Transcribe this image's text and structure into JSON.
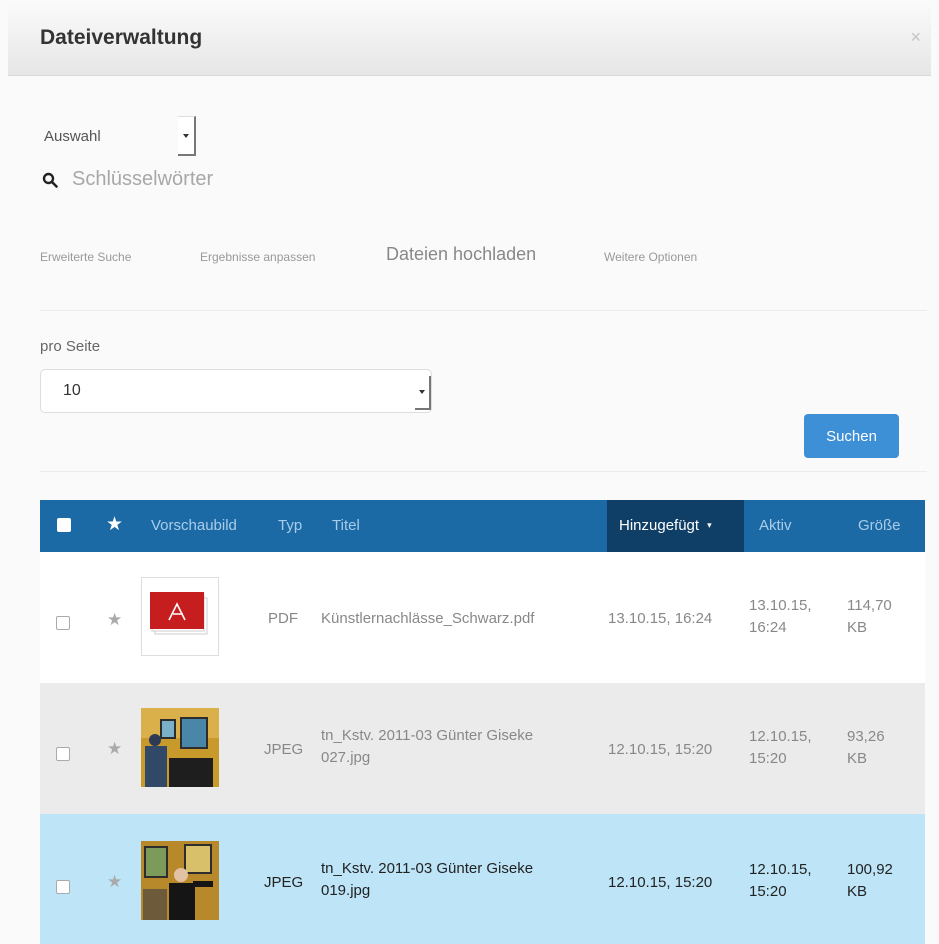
{
  "dialog": {
    "title": "Dateiverwaltung",
    "close": "×"
  },
  "auswahl": {
    "label": "Auswahl"
  },
  "search": {
    "placeholder": "Schlüsselwörter"
  },
  "tabs": [
    "Erweiterte Suche",
    "Ergebnisse anpassen",
    "Dateien hochladen",
    "Weitere Optionen"
  ],
  "per_page": {
    "label": "pro Seite",
    "value": "10"
  },
  "search_button": "Suchen",
  "table": {
    "columns": {
      "preview": "Vorschaubild",
      "type": "Typ",
      "title": "Titel",
      "added": "Hinzugefügt",
      "active": "Aktiv",
      "size": "Größe"
    },
    "sorted_indicator": "▾",
    "rows": [
      {
        "type": "PDF",
        "title_line1": "Künstlernachlässe_Schwarz.pdf",
        "title_line2": "",
        "added": "13.10.15, 16:24",
        "active_date": "13.10.15,",
        "active_time": "16:24",
        "size_num": "114,70",
        "size_unit": "KB",
        "thumb": "pdf-icon"
      },
      {
        "type": "JPEG",
        "title_line1": "tn_Kstv. 2011-03 Günter Giseke",
        "title_line2": "027.jpg",
        "added": "12.10.15, 15:20",
        "active_date": "12.10.15,",
        "active_time": "15:20",
        "size_num": "93,26",
        "size_unit": "KB",
        "thumb": "photo-thumbnail"
      },
      {
        "type": "JPEG",
        "title_line1": "tn_Kstv. 2011-03 Günter Giseke",
        "title_line2": "019.jpg",
        "added": "12.10.15, 15:20",
        "active_date": "12.10.15,",
        "active_time": "15:20",
        "size_num": "100,92",
        "size_unit": "KB",
        "thumb": "photo-thumbnail"
      }
    ]
  },
  "colors": {
    "header_blue": "#1b6aa6",
    "sorted_column": "#0f3e66",
    "selected_row": "#bde4f7",
    "button": "#3d8fd6"
  }
}
